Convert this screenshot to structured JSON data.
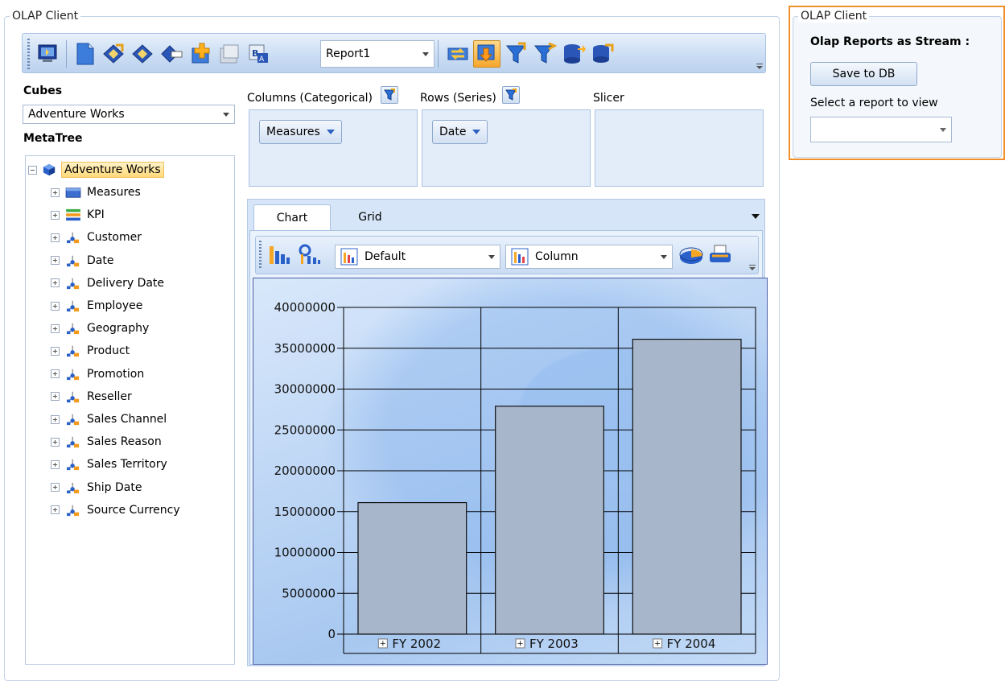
{
  "main": {
    "title": "OLAP Client",
    "toolbar": {
      "report_select": "Report1",
      "icons": [
        "connect-icon",
        "new-report-icon",
        "open-report-icon",
        "save-report-icon",
        "save-as-icon",
        "add-report-icon",
        "copy-report-icon",
        "rename-report-icon",
        "swap-axes-icon",
        "drill-down-icon",
        "filter-icon",
        "filter-excel-icon",
        "database-icon",
        "export-db-icon"
      ]
    },
    "cubes_label": "Cubes",
    "cube_selected": "Adventure Works",
    "metatree_label": "MetaTree",
    "tree": {
      "root": "Adventure Works",
      "items": [
        "Measures",
        "KPI",
        "Customer",
        "Date",
        "Delivery Date",
        "Employee",
        "Geography",
        "Product",
        "Promotion",
        "Reseller",
        "Sales Channel",
        "Sales Reason",
        "Sales Territory",
        "Ship Date",
        "Source Currency"
      ]
    },
    "axes": {
      "columns_label": "Columns (Categorical)",
      "rows_label": "Rows (Series)",
      "slicer_label": "Slicer",
      "columns_item": "Measures",
      "rows_item": "Date"
    },
    "tabs": [
      {
        "label": "Chart",
        "active": true
      },
      {
        "label": "Grid",
        "active": false
      }
    ],
    "chart_toolbar": {
      "palette": "Default",
      "chart_type": "Column"
    }
  },
  "side": {
    "title": "OLAP Client",
    "heading": "Olap Reports as Stream :",
    "save_button": "Save to DB",
    "select_label": "Select a report to view",
    "select_value": ""
  },
  "chart_data": {
    "type": "bar",
    "categories": [
      "FY 2002",
      "FY 2003",
      "FY 2004"
    ],
    "values": [
      16100000,
      27900000,
      36100000
    ],
    "ylim": [
      0,
      40000000
    ],
    "yticks": [
      "40000000",
      "35000000",
      "30000000",
      "25000000",
      "20000000",
      "15000000",
      "10000000",
      "5000000",
      "0"
    ],
    "grid": true,
    "bar_color": "#a7b6cb"
  }
}
